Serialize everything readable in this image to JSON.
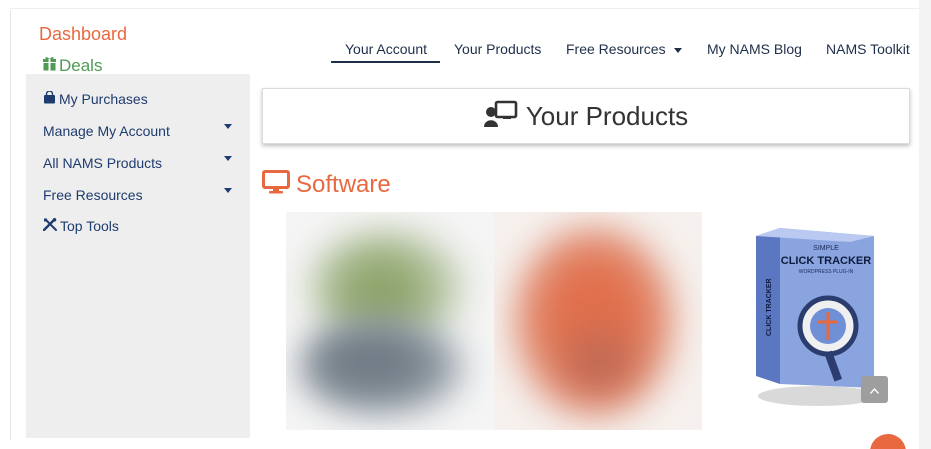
{
  "brand": {
    "dashboard": "Dashboard",
    "deals": "Deals"
  },
  "sidebar": {
    "items": [
      {
        "label": "My Purchases",
        "icon": "shopping-bag-icon"
      },
      {
        "label": "Manage My Account",
        "has_dropdown": true
      },
      {
        "label": "All NAMS Products",
        "has_dropdown": true
      },
      {
        "label": "Free Resources",
        "has_dropdown": true
      },
      {
        "label": "Top Tools",
        "icon": "tools-icon"
      }
    ]
  },
  "topnav": {
    "items": [
      {
        "label": "Your Account",
        "active": true
      },
      {
        "label": "Your Products"
      },
      {
        "label": "Free Resources",
        "has_dropdown": true
      },
      {
        "label": "My NAMS Blog"
      },
      {
        "label": "NAMS Toolkit"
      }
    ]
  },
  "main": {
    "products_title": "Your Products",
    "section_title": "Software"
  },
  "product_box": {
    "line1": "SIMPLE",
    "line2": "CLICK TRACKER",
    "line3": "WORDPRESS PLUG-IN",
    "side": "CLICK TRACKER"
  },
  "colors": {
    "accent_orange": "#e8683f",
    "deals_green": "#4f9a55",
    "nav_navy": "#1e2f4a",
    "sidebar_bg": "#eeeeee"
  }
}
